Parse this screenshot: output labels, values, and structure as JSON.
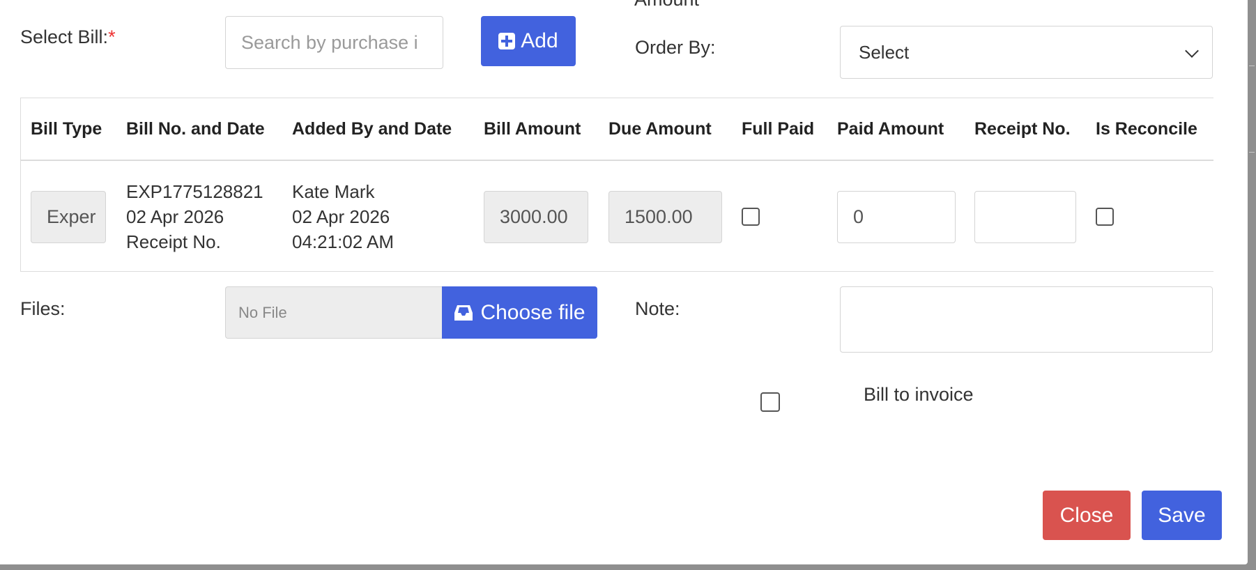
{
  "form": {
    "select_bill_label": "Select Bill:",
    "required_mark": "*",
    "search_placeholder": "Search by purchase i",
    "add_label": "Add",
    "amount_label_cut": "Amount",
    "order_by_label": "Order By:",
    "order_by_value": "Select"
  },
  "table": {
    "headers": [
      "Bill Type",
      "Bill No. and Date",
      "Added By and Date",
      "Bill Amount",
      "Due Amount",
      "Full Paid",
      "Paid Amount",
      "Receipt No.",
      "Is Reconcile"
    ],
    "rows": [
      {
        "bill_type": "Exper",
        "bill_no": "EXP1775128821",
        "bill_date": "02 Apr 2026",
        "bill_receipt": "Receipt No.",
        "added_by": "Kate Mark",
        "added_date": "02 Apr 2026",
        "added_time": "04:21:02 AM",
        "bill_amount": "3000.00",
        "due_amount": "1500.00",
        "full_paid": false,
        "paid_amount": "0",
        "receipt_no": "",
        "is_reconcile": false
      }
    ]
  },
  "files": {
    "label": "Files:",
    "no_file": "No File",
    "choose_label": "Choose file"
  },
  "note": {
    "label": "Note:",
    "value": ""
  },
  "bill_to_invoice": {
    "label": "Bill to invoice",
    "checked": false
  },
  "footer": {
    "close_label": "Close",
    "save_label": "Save"
  },
  "colors": {
    "primary": "#4262de",
    "danger": "#d9534f",
    "required": "#e33333"
  }
}
